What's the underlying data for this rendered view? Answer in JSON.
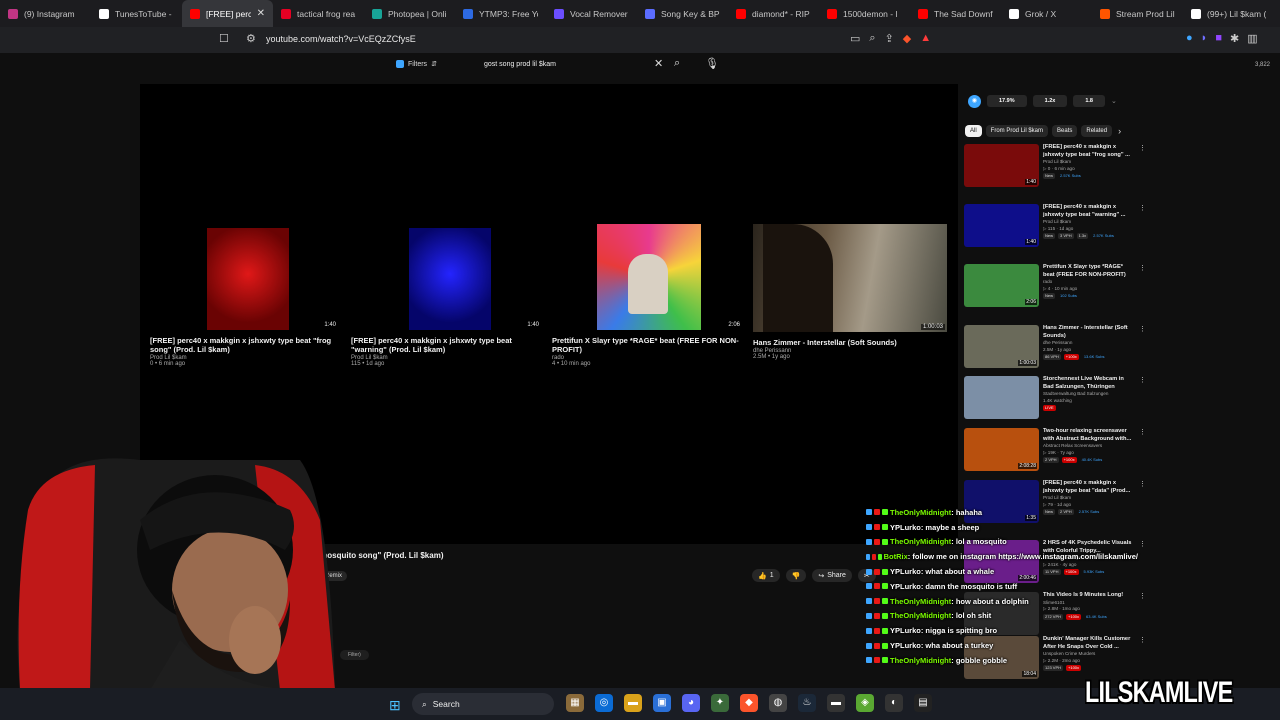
{
  "browser": {
    "tabs": [
      {
        "label": "(9) Instagram",
        "color": "#c13584",
        "active": false
      },
      {
        "label": "TunesToTube - l",
        "color": "#ffffff",
        "active": false
      },
      {
        "label": "[FREE] perc4",
        "color": "#ff0000",
        "active": true
      },
      {
        "label": "tactical frog rea",
        "color": "#e60023",
        "active": false
      },
      {
        "label": "Photopea | Onli",
        "color": "#18a497",
        "active": false
      },
      {
        "label": "YTMP3: Free You",
        "color": "#2d6ae3",
        "active": false
      },
      {
        "label": "Vocal Remover a",
        "color": "#6b4eff",
        "active": false
      },
      {
        "label": "Song Key & BPM",
        "color": "#5b6cff",
        "active": false
      },
      {
        "label": "diamond* - RIP",
        "color": "#ff0000",
        "active": false
      },
      {
        "label": "1500demon - l",
        "color": "#ff0000",
        "active": false
      },
      {
        "label": "The Sad Downfa",
        "color": "#ff0000",
        "active": false
      },
      {
        "label": "Grok / X",
        "color": "#ffffff",
        "active": false
      },
      {
        "label": "Stream Prod Lil",
        "color": "#ff5500",
        "active": false
      },
      {
        "label": "(99+) Lil $kam (@",
        "color": "#ffffff",
        "active": false
      }
    ],
    "url": "youtube.com/watch?v=VcEQzZCfysE"
  },
  "youtube": {
    "filters_label": "Filters",
    "search_query": "gost song prod lil $kam",
    "view_counter": "3,822",
    "endcards": [
      {
        "title": "[FREE] perc40 x makkgin x jshxwty type beat \"frog song\" (Prod. Lil $kam)",
        "channel": "Prod Lil $kam",
        "meta": "0 • 6 min ago",
        "duration": "1:40",
        "thumb": "red"
      },
      {
        "title": "[FREE] perc40 x makkgin x jshxwty type beat \"warning\" (Prod. Lil $kam)",
        "channel": "Prod Lil $kam",
        "meta": "115 • 1d ago",
        "duration": "1:40",
        "thumb": "blue"
      },
      {
        "title": "Prettifun X Slayr type *RAGE* beat (FREE FOR NON-PROFIT)",
        "channel": "rado",
        "meta": "4 • 10 min ago",
        "duration": "2:06",
        "thumb": "art"
      },
      {
        "title": "Hans Zimmer - Interstellar (Soft Sounds)",
        "channel": "dhe Perissann",
        "meta": "2.5M • 1y ago",
        "duration": "1:00:03",
        "thumb": "photo"
      }
    ],
    "video_title": "st \"mosquito song\" (Prod. Lil $kam)",
    "remix_label": "Remix",
    "actions": {
      "like_count": "1",
      "share_label": "Share"
    },
    "filter_chip": "Filter)",
    "speed_chips": [
      "17.9%",
      "1.2x",
      "1.8"
    ],
    "chips": [
      "All",
      "From Prod Lil $kam",
      "Beats",
      "Related"
    ],
    "recommendations": [
      {
        "title": "[FREE] perc40 x makkgin x jshxwty type beat \"frog song\" ...",
        "channel": "Prod Lil $kam",
        "meta": "▷ 0 · 6 min ago",
        "badges": [
          "New",
          "2.57K Subs"
        ],
        "duration": "1:40",
        "thumb": "#7a0b0b"
      },
      {
        "title": "[FREE] perc40 x makkgin x jshxwty type beat \"warning\" ...",
        "channel": "Prod Lil $kam",
        "meta": "▷ 115 · 1d ago",
        "badges": [
          "New",
          "3 VPH",
          "1.3x",
          "2.57K Subs"
        ],
        "duration": "1:40",
        "thumb": "#0e0e8a"
      },
      {
        "title": "Prettifun X Slayr type *RAGE* beat (FREE FOR NON-PROFIT)",
        "channel": "rado",
        "meta": "▷ 4 · 10 min ago",
        "badges": [
          "New",
          "102 Subs"
        ],
        "duration": "2:06",
        "thumb": "#3b8a3e"
      },
      {
        "title": "Hans Zimmer - Interstellar (Soft Sounds)",
        "channel": "dhe Perissann",
        "meta": "2.5M · 1y ago",
        "badges": [
          "86 VPH",
          "+100x",
          "13.6K Subs"
        ],
        "duration": "1:00:03",
        "thumb": "#6a6a5a"
      },
      {
        "title": "Storchennest Live Webcam in Bad Salzungen, Thüringen",
        "channel": "Stadtverwaltung Bad Salzungen",
        "meta": "1.4K watching",
        "badges": [
          "LIVE"
        ],
        "duration": "",
        "thumb": "#7c8fa6"
      },
      {
        "title": "Two-hour relaxing screensaver with Abstract Background with...",
        "channel": "Abstract Relax Screensavers",
        "meta": "▷ 19K · 7y ago",
        "badges": [
          "2 VPH",
          "+100x",
          "40.4K Subs"
        ],
        "duration": "2:08:28",
        "thumb": "#b8500e"
      },
      {
        "title": "[FREE] perc40 x makkgin x jshxwty type beat \"data\" (Prod...",
        "channel": "Prod Lil $kam",
        "meta": "▷ 79 · 1d ago",
        "badges": [
          "New",
          "2 VPH",
          "2.57K Subs"
        ],
        "duration": "1:35",
        "thumb": "#10106a"
      },
      {
        "title": "2 HRS of 4K Psychedelic Visuals with Colorful Trippy...",
        "channel": "Healing Minds Eye",
        "meta": "▷ 241K · 4y ago",
        "badges": [
          "11 VPH",
          "+100x",
          "5.93K Subs"
        ],
        "duration": "2:00:46",
        "thumb": "#6a1e8a"
      },
      {
        "title": "This Video Is 9 Minutes Long!",
        "channel": "Slime6101",
        "meta": "▷ 2.8M · 1mo ago",
        "badges": [
          "272 VPH",
          "+100x",
          "63.4K Subs"
        ],
        "duration": "",
        "thumb": "#2a2a2a"
      },
      {
        "title": "Dunkin' Manager Kills Customer After He Snaps Over Cold ...",
        "channel": "Unspoken Crime Murders",
        "meta": "▷ 2.2M · 2mo ago",
        "badges": [
          "123 VPH",
          "+100x"
        ],
        "duration": "18:04",
        "thumb": "#5a4a3a"
      }
    ]
  },
  "chat": [
    {
      "user": "TheOnlyMidnight",
      "msg": ": hahaha",
      "color": "#7cfc00"
    },
    {
      "user": "YPLurko",
      "msg": ": maybe a sheep",
      "color": "#ffffff"
    },
    {
      "user": "TheOnlyMidnight",
      "msg": ": lol a mosquito",
      "color": "#7cfc00"
    },
    {
      "user": "BotRix",
      "msg": ": follow me on instagram https://www.instagram.com/lilskamlive/",
      "color": "#7cfc00"
    },
    {
      "user": "YPLurko",
      "msg": ": what about a whale",
      "color": "#ffffff"
    },
    {
      "user": "YPLurko",
      "msg": ": damn the mosquito is tuff",
      "color": "#ffffff"
    },
    {
      "user": "TheOnlyMidnight",
      "msg": ": how about a dolphin",
      "color": "#7cfc00"
    },
    {
      "user": "TheOnlyMidnight",
      "msg": ": lol oh shit",
      "color": "#7cfc00"
    },
    {
      "user": "YPLurko",
      "msg": ": nigga is spitting bro",
      "color": "#ffffff"
    },
    {
      "user": "YPLurko",
      "msg": ": wha about a turkey",
      "color": "#ffffff"
    },
    {
      "user": "TheOnlyMidnight",
      "msg": ": gobble gobble",
      "color": "#7cfc00"
    }
  ],
  "taskbar": {
    "search_label": "Search"
  },
  "watermark": "LILSKAMLIVE"
}
